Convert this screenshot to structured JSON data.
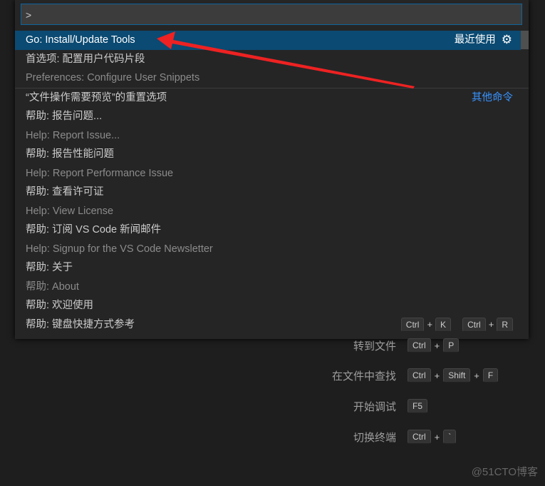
{
  "input": {
    "value": ">"
  },
  "rows": [
    {
      "label": "Go: Install/Update Tools",
      "right": "最近使用",
      "icon": "gear-icon",
      "selected": true
    },
    {
      "label": "首选项: 配置用户代码片段"
    },
    {
      "label": "Preferences: Configure User Snippets",
      "sub": true
    },
    {
      "label": "“文件操作需要预览”的重置选项",
      "right": "其他命令"
    },
    {
      "label": "帮助: 报告问题..."
    },
    {
      "label": "Help: Report Issue...",
      "sub": true
    },
    {
      "label": "帮助: 报告性能问题"
    },
    {
      "label": "Help: Report Performance Issue",
      "sub": true
    },
    {
      "label": "帮助: 查看许可证"
    },
    {
      "label": "Help: View License",
      "sub": true
    },
    {
      "label": "帮助: 订阅 VS Code 新闻邮件"
    },
    {
      "label": "Help: Signup for the VS Code Newsletter",
      "sub": true
    },
    {
      "label": "帮助: 关于"
    },
    {
      "label": "帮助: About",
      "sub": true
    },
    {
      "label": "帮助: 欢迎使用"
    },
    {
      "label": "帮助: 键盘快捷方式参考",
      "keys": [
        "Ctrl",
        "K",
        "Ctrl",
        "R"
      ]
    }
  ],
  "shortcuts": [
    {
      "label": "转到文件",
      "keys": [
        "Ctrl",
        "P"
      ]
    },
    {
      "label": "在文件中查找",
      "keys": [
        "Ctrl",
        "Shift",
        "F"
      ]
    },
    {
      "label": "开始调试",
      "keys": [
        "F5"
      ]
    },
    {
      "label": "切换终端",
      "keys": [
        "Ctrl",
        "`"
      ]
    }
  ],
  "plus": "+",
  "watermark": "@51CTO博客"
}
